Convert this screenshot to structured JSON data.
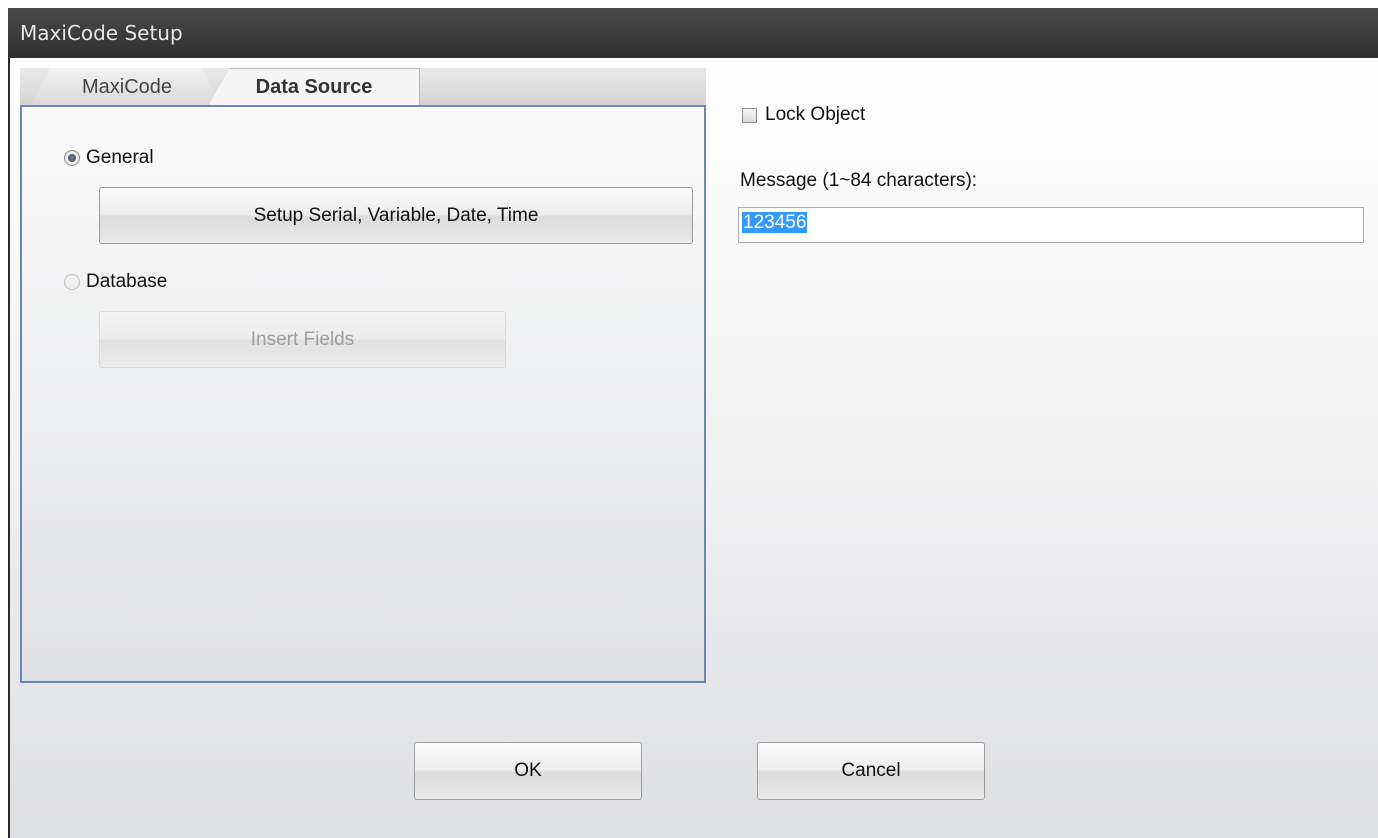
{
  "window": {
    "title": "MaxiCode Setup"
  },
  "tabs": [
    {
      "label": "MaxiCode",
      "active": false
    },
    {
      "label": "Data Source",
      "active": true
    }
  ],
  "data_source": {
    "general": {
      "label": "General",
      "checked": true
    },
    "setup_button": {
      "label": "Setup Serial, Variable, Date, Time"
    },
    "database": {
      "label": "Database",
      "checked": false
    },
    "insert_fields_button": {
      "label": "Insert Fields",
      "enabled": false
    }
  },
  "lock_object": {
    "label": "Lock Object",
    "checked": false
  },
  "message": {
    "label": "Message (1~84 characters):",
    "value": "123456"
  },
  "footer": {
    "ok_label": "OK",
    "cancel_label": "Cancel"
  },
  "colors": {
    "selection": "#3399ff",
    "panel_border": "#6d86b5",
    "titlebar": "#3c3c3c"
  }
}
